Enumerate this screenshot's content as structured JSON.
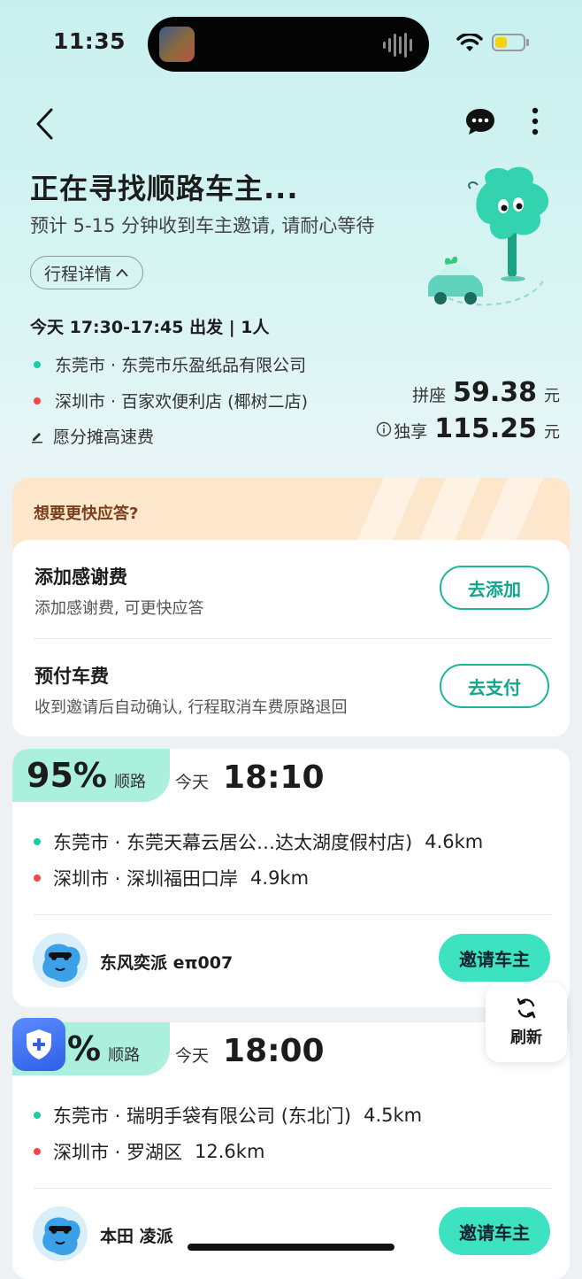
{
  "status_bar": {
    "time": "11:35"
  },
  "header": {
    "title": "正在寻找顺路车主...",
    "subtitle": "预计 5-15 分钟收到车主邀请, 请耐心等待",
    "detail_button": "行程详情",
    "depart_info": "今天 17:30-17:45 出发 | 1人",
    "origin": "东莞市 · 东莞市乐盈纸品有限公司",
    "destination": "深圳市 · 百家欢便利店 (椰树二店)",
    "toll_note": "愿分摊高速费",
    "shared_label": "拼座",
    "shared_price": "59.38",
    "exclusive_label": "独享",
    "exclusive_price": "115.25",
    "unit": "元"
  },
  "promo": {
    "heading": "想要更快应答?",
    "items": [
      {
        "title": "添加感谢费",
        "desc": "添加感谢费, 可更快应答",
        "button": "去添加"
      },
      {
        "title": "预付车费",
        "desc": "收到邀请后自动确认, 行程取消车费原路退回",
        "button": "去支付"
      }
    ]
  },
  "trips": [
    {
      "match": "95%",
      "match_label": "顺路",
      "day": "今天",
      "time": "18:10",
      "from": "东莞市 · 东莞天幕云居公…达太湖度假村店)",
      "from_dist": "4.6km",
      "to": "深圳市 · 深圳福田口岸",
      "to_dist": "4.9km",
      "driver": "东风奕派 eπ007",
      "button": "邀请车主"
    },
    {
      "match": "%",
      "match_label": "顺路",
      "day": "今天",
      "time": "18:00",
      "from": "东莞市 · 瑞明手袋有限公司 (东北门)",
      "from_dist": "4.5km",
      "to": "深圳市 · 罗湖区",
      "to_dist": "12.6km",
      "driver": "本田 凌派",
      "button": "邀请车主"
    }
  ],
  "refresh_label": "刷新",
  "colors": {
    "accent": "#11a58b",
    "origin_dot": "#1ccaa5",
    "dest_dot": "#f04848",
    "invite_bg": "#3de3c1"
  }
}
